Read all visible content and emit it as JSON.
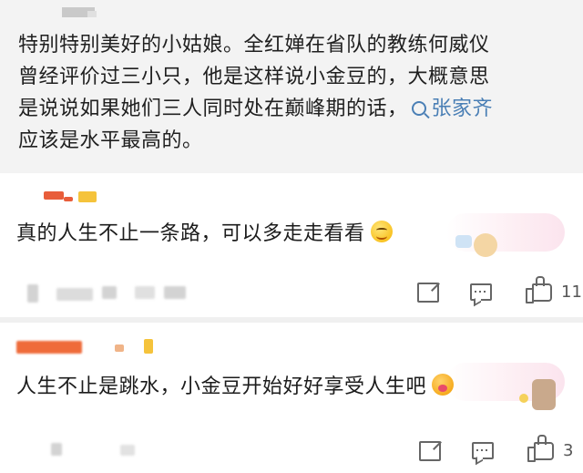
{
  "post": {
    "text_line1": "特别特别美好的小姑娘。全红婵在省队的教练何威仪",
    "text_line2": "曾经评价过三小只，他是这样说小金豆的，大概意思",
    "text_line3_prefix": "是说说如果她们三人同时处在巅峰期的话，",
    "mention": "张家齐",
    "text_line4": "应该是水平最高的。"
  },
  "comments": [
    {
      "text": "真的人生不止一条路，可以多走走看看",
      "emoji": "smile-emoji",
      "actions": {
        "share": "share-icon",
        "reply": "comment-icon",
        "like_count": "11"
      }
    },
    {
      "text": "人生不止是跳水，小金豆开始好好享受人生吧",
      "emoji": "kiss-emoji",
      "actions": {
        "share": "share-icon",
        "reply": "comment-icon",
        "like_count": "3"
      }
    }
  ],
  "colors": {
    "mention": "#4a7fb5",
    "icon": "#666666",
    "post_bg": "#f3f3f3"
  }
}
